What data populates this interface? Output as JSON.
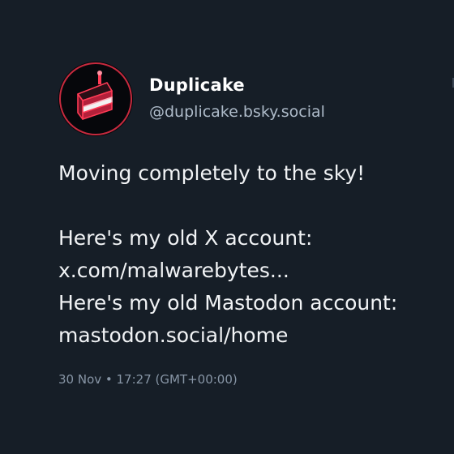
{
  "post": {
    "author": {
      "display_name": "Duplicake",
      "handle": "@duplicake.bsky.social",
      "avatar_icon": "cake-slice-icon"
    },
    "text": {
      "line1": "Moving completely to the sky!",
      "line2": "Here's my old X account:",
      "line3": "x.com/malwarebytes...",
      "line4": "Here's my old Mastodon account:",
      "line5": "mastodon.social/home"
    },
    "timestamp": "30 Nov • 17:27 (GMT+00:00)"
  },
  "colors": {
    "background": "#161e27",
    "text": "#f1f3f5",
    "handle": "#aebbc9",
    "meta": "#8795a5",
    "avatar_accent": "#e8324a"
  }
}
